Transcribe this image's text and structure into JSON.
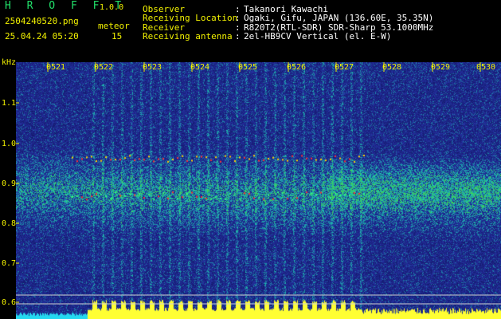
{
  "header": {
    "app_name": "H R O F F T",
    "app_version": "1.0.0",
    "filename": "2504240520.png",
    "datetime": "25.04.24 05:20",
    "meteor_label": "meteor",
    "meteor_count": "15",
    "info": [
      {
        "key": "Observer",
        "sep": ":",
        "value": "Takanori Kawachi"
      },
      {
        "key": "Receiving Location",
        "sep": ":",
        "value": "Ogaki, Gifu, JAPAN (136.60E, 35.35N)"
      },
      {
        "key": "Receiver",
        "sep": ":",
        "value": "R820T2(RTL-SDR) SDR-Sharp 53.1000MHz"
      },
      {
        "key": "Receiving antenna",
        "sep": ":",
        "value": "2el-HB9CV Vertical (el. E-W)"
      }
    ]
  },
  "plot": {
    "y_unit": "kHz",
    "y_ticks": [
      "1.1",
      "1.0",
      "0.9",
      "0.8",
      "0.7",
      "0.6"
    ],
    "x_ticks": [
      "0521",
      "0522",
      "0523",
      "0524",
      "0525",
      "0526",
      "0527",
      "0528",
      "0529",
      "0530"
    ]
  },
  "colors": {
    "background": "#000000",
    "label_yellow": "#f2f200",
    "app_green": "#21e06a",
    "spectrum_base": "#1a1f8c",
    "signal_green": "#2bd46a",
    "signal_red": "#ff3030",
    "meter_yellow": "#ffff33",
    "meter_cyan": "#25d8f0"
  }
}
